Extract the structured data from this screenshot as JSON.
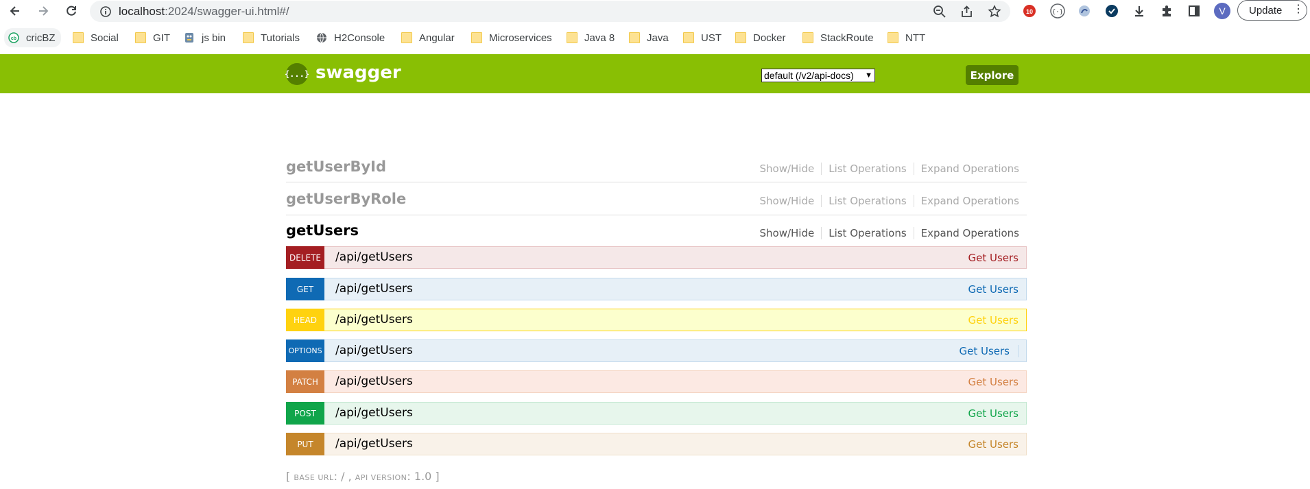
{
  "browser": {
    "url_host": "localhost",
    "url_path": ":2024/swagger-ui.html#/",
    "avatar_letter": "V",
    "update_label": "Update",
    "menu_dots": "⋮"
  },
  "bookmarks": [
    {
      "label": "cricBZ",
      "icon": "cricbz-icon"
    },
    {
      "label": "Social",
      "icon": "folder-icon"
    },
    {
      "label": "GIT",
      "icon": "folder-icon"
    },
    {
      "label": "js bin",
      "icon": "jsbin-icon"
    },
    {
      "label": "Tutorials",
      "icon": "folder-icon"
    },
    {
      "label": "H2Console",
      "icon": "globe-icon"
    },
    {
      "label": "Angular",
      "icon": "folder-icon"
    },
    {
      "label": "Microservices",
      "icon": "folder-icon"
    },
    {
      "label": "Java 8",
      "icon": "folder-icon"
    },
    {
      "label": "Java",
      "icon": "folder-icon"
    },
    {
      "label": "UST",
      "icon": "folder-icon"
    },
    {
      "label": "Docker",
      "icon": "folder-icon"
    },
    {
      "label": "StackRoute",
      "icon": "folder-icon"
    },
    {
      "label": "NTT",
      "icon": "folder-icon"
    }
  ],
  "header": {
    "logo_glyph": "{...}",
    "logo_text": "swagger",
    "spec_select": "default (/v2/api-docs)",
    "explore_label": "Explore",
    "brand_color": "#89bf04"
  },
  "resources": [
    {
      "name": "getUserById",
      "actions": [
        "Show/Hide",
        "List Operations",
        "Expand Operations"
      ]
    },
    {
      "name": "getUserByRole",
      "actions": [
        "Show/Hide",
        "List Operations",
        "Expand Operations"
      ]
    },
    {
      "name": "getUsers",
      "actions": [
        "Show/Hide",
        "List Operations",
        "Expand Operations"
      ]
    }
  ],
  "operations": [
    {
      "method": "DELETE",
      "path": "/api/getUsers",
      "summary": "Get Users"
    },
    {
      "method": "GET",
      "path": "/api/getUsers",
      "summary": "Get Users"
    },
    {
      "method": "HEAD",
      "path": "/api/getUsers",
      "summary": "Get Users"
    },
    {
      "method": "OPTIONS",
      "path": "/api/getUsers",
      "summary": "Get Users"
    },
    {
      "method": "PATCH",
      "path": "/api/getUsers",
      "summary": "Get Users"
    },
    {
      "method": "POST",
      "path": "/api/getUsers",
      "summary": "Get Users"
    },
    {
      "method": "PUT",
      "path": "/api/getUsers",
      "summary": "Get Users"
    }
  ],
  "footer": {
    "open": "[ ",
    "base_url_label": "base url",
    "base_url_value": ": / , ",
    "api_version_label": "api version",
    "api_version_value": ": 1.0 ]"
  }
}
